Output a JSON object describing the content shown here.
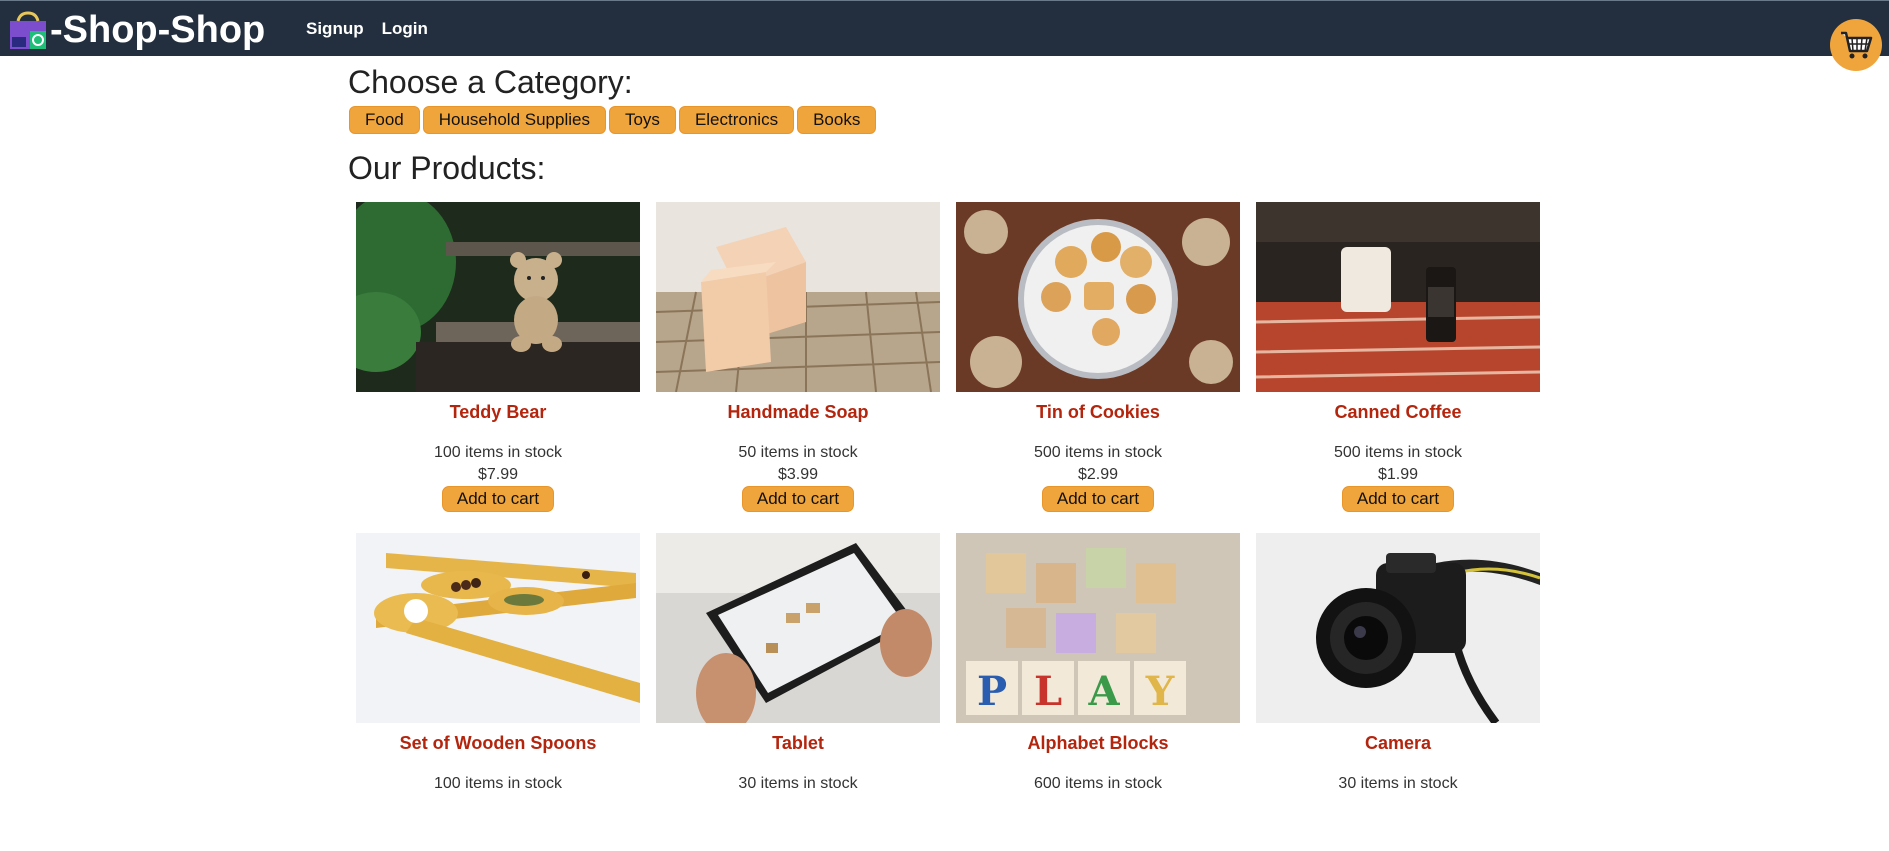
{
  "header": {
    "brand": "-Shop-Shop",
    "logo_icon": "shopping-bag-icon",
    "nav": [
      "Signup",
      "Login"
    ],
    "cart_icon": "shopping-cart-icon",
    "colors": {
      "bar": "#232f3e",
      "accent": "#f0a53c"
    }
  },
  "categories": {
    "heading": "Choose a Category:",
    "items": [
      "Food",
      "Household Supplies",
      "Toys",
      "Electronics",
      "Books"
    ]
  },
  "products": {
    "heading": "Our Products:",
    "add_label": "Add to cart",
    "items": [
      {
        "name": "Teddy Bear",
        "stock": "100 items in stock",
        "price": "$7.99"
      },
      {
        "name": "Handmade Soap",
        "stock": "50 items in stock",
        "price": "$3.99"
      },
      {
        "name": "Tin of Cookies",
        "stock": "500 items in stock",
        "price": "$2.99"
      },
      {
        "name": "Canned Coffee",
        "stock": "500 items in stock",
        "price": "$1.99"
      },
      {
        "name": "Set of Wooden Spoons",
        "stock": "100 items in stock",
        "price": ""
      },
      {
        "name": "Tablet",
        "stock": "30 items in stock",
        "price": ""
      },
      {
        "name": "Alphabet Blocks",
        "stock": "600 items in stock",
        "price": ""
      },
      {
        "name": "Camera",
        "stock": "30 items in stock",
        "price": ""
      }
    ]
  }
}
